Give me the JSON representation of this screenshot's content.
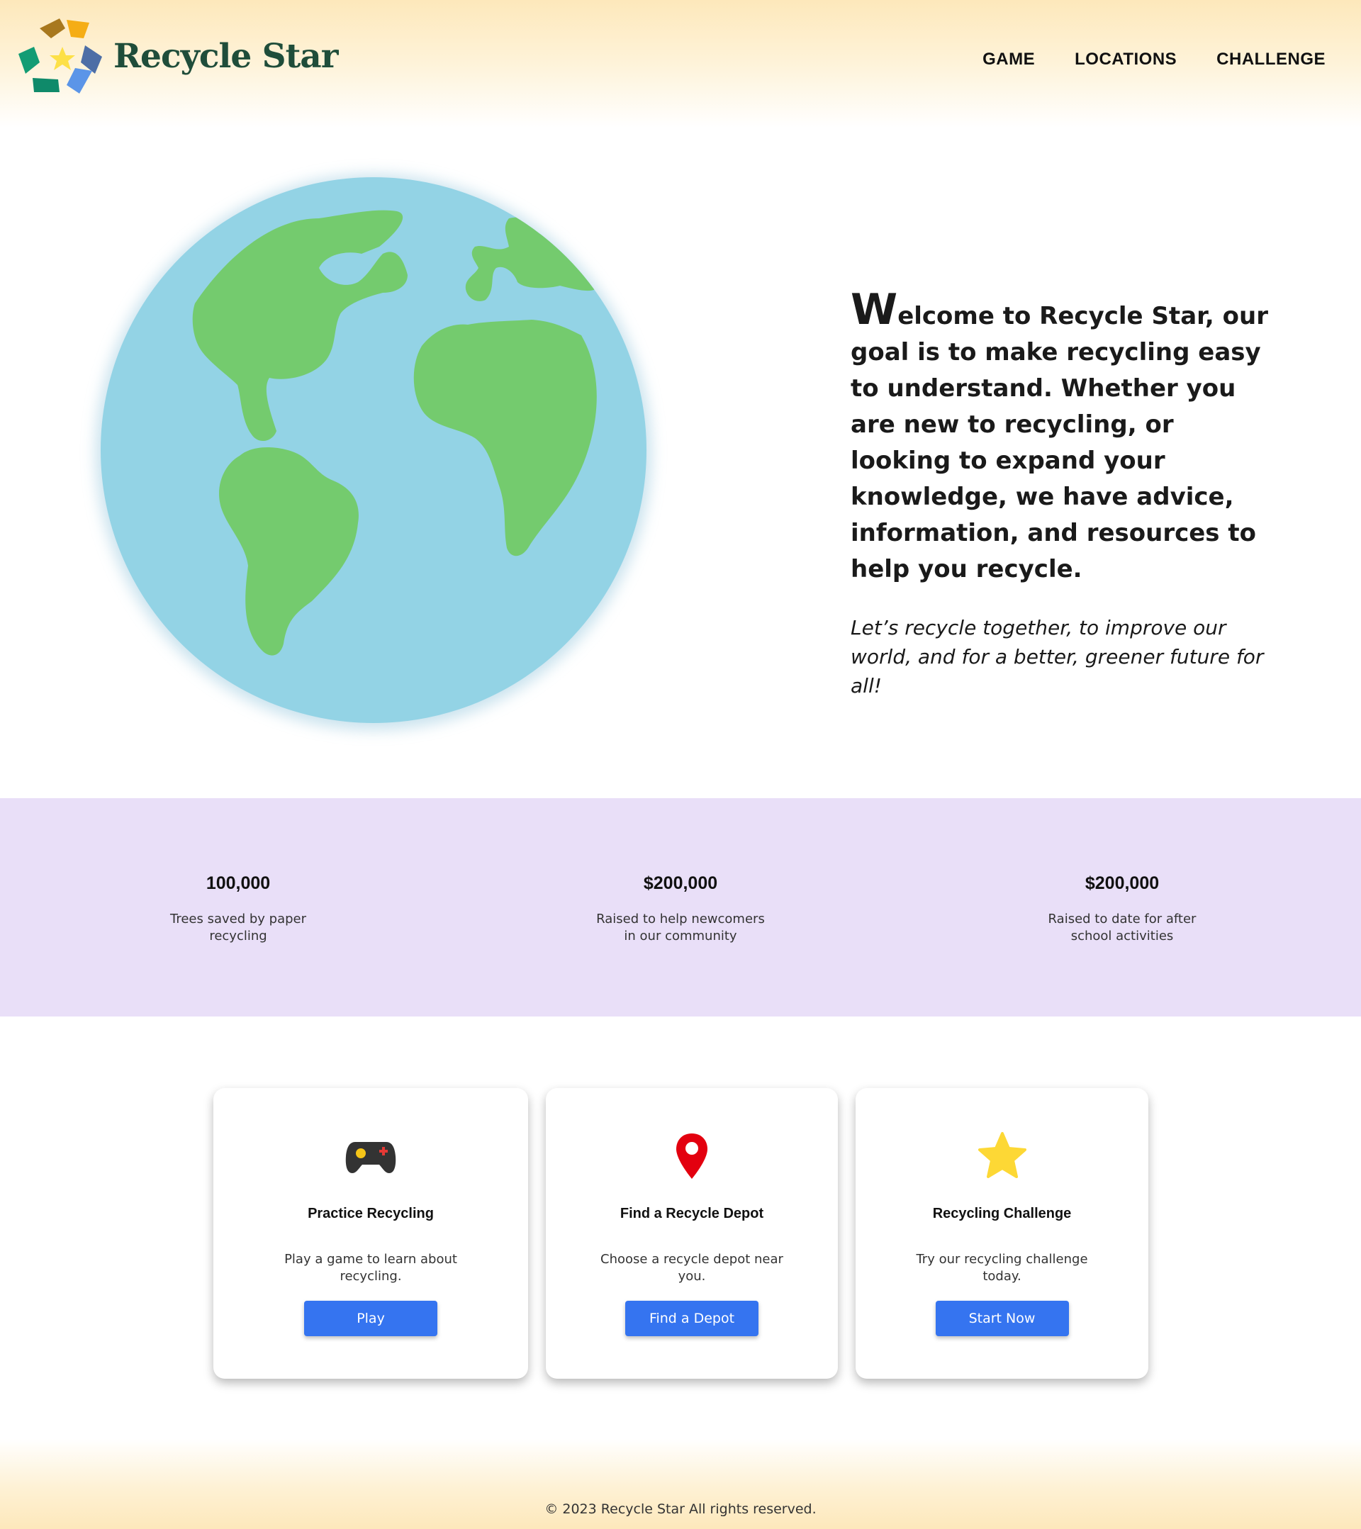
{
  "header": {
    "brand": "Recycle Star",
    "nav": [
      {
        "label": "GAME"
      },
      {
        "label": "LOCATIONS"
      },
      {
        "label": "CHALLENGE"
      }
    ]
  },
  "hero": {
    "first_letter": "W",
    "main_text": "elcome to Recycle Star, our goal is to make recycling easy to understand. Whether you are new to recycling, or looking to expand your knowledge, we have advice, information, and resources to help you recycle.",
    "sub_text": "Let’s recycle together, to improve our world, and for a better, greener future for all!"
  },
  "stats": [
    {
      "value": "100,000",
      "label": "Trees saved by paper recycling"
    },
    {
      "value": "$200,000",
      "label": "Raised to help newcomers in our community"
    },
    {
      "value": "$200,000",
      "label": "Raised to date for after school activities"
    }
  ],
  "cards": [
    {
      "icon": "gamepad-icon",
      "title": "Practice Recycling",
      "desc": "Play a game to learn about recycling.",
      "button": "Play"
    },
    {
      "icon": "map-pin-icon",
      "title": "Find a Recycle Depot",
      "desc": "Choose a recycle depot near you.",
      "button": "Find a Depot"
    },
    {
      "icon": "star-icon",
      "title": "Recycling Challenge",
      "desc": "Try our recycling challenge today.",
      "button": "Start Now"
    }
  ],
  "footer": {
    "text": "© 2023 Recycle Star All rights reserved."
  },
  "colors": {
    "brand_green": "#1f4d3a",
    "ocean": "#93d3e5",
    "land": "#74cb6e",
    "stats_band": "#e9dff8",
    "button": "#3574f0",
    "header_gradient": "#fde8bb"
  }
}
